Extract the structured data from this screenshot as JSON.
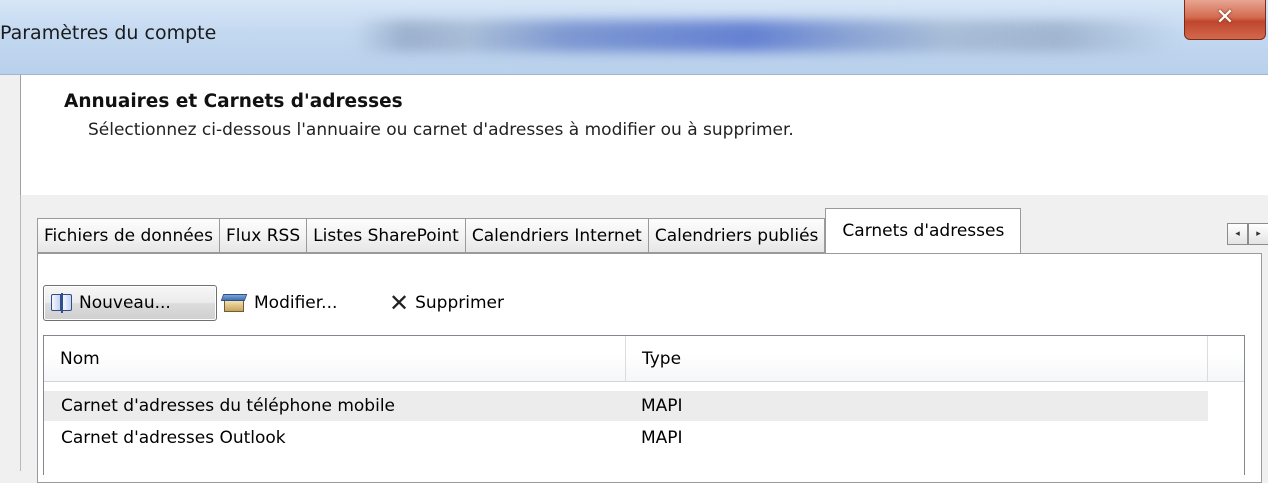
{
  "window": {
    "title": "Paramètres du compte",
    "close_glyph": "✕",
    "close_icon": "close-icon"
  },
  "header": {
    "title": "Annuaires et Carnets d'adresses",
    "subtitle": "Sélectionnez ci-dessous l'annuaire ou carnet d'adresses à modifier ou à supprimer."
  },
  "tabs": [
    {
      "label": "Fichiers de données",
      "active": false
    },
    {
      "label": "Flux RSS",
      "active": false
    },
    {
      "label": "Listes SharePoint",
      "active": false
    },
    {
      "label": "Calendriers Internet",
      "active": false
    },
    {
      "label": "Calendriers publiés",
      "active": false
    },
    {
      "label": "Carnets d'adresses",
      "active": true
    }
  ],
  "tab_scroll": {
    "left_glyph": "◂",
    "right_glyph": "▸"
  },
  "toolbar": {
    "new_label": "Nouveau...",
    "new_icon": "address-book-icon",
    "edit_label": "Modifier...",
    "edit_icon": "edit-icon",
    "delete_label": "Supprimer",
    "delete_glyph": "✕",
    "delete_icon": "delete-icon"
  },
  "list": {
    "columns": [
      "Nom",
      "Type"
    ],
    "rows": [
      {
        "name": "Carnet d'adresses du téléphone mobile",
        "type": "MAPI",
        "selected": true
      },
      {
        "name": "Carnet d'adresses Outlook",
        "type": "MAPI",
        "selected": false
      }
    ]
  }
}
